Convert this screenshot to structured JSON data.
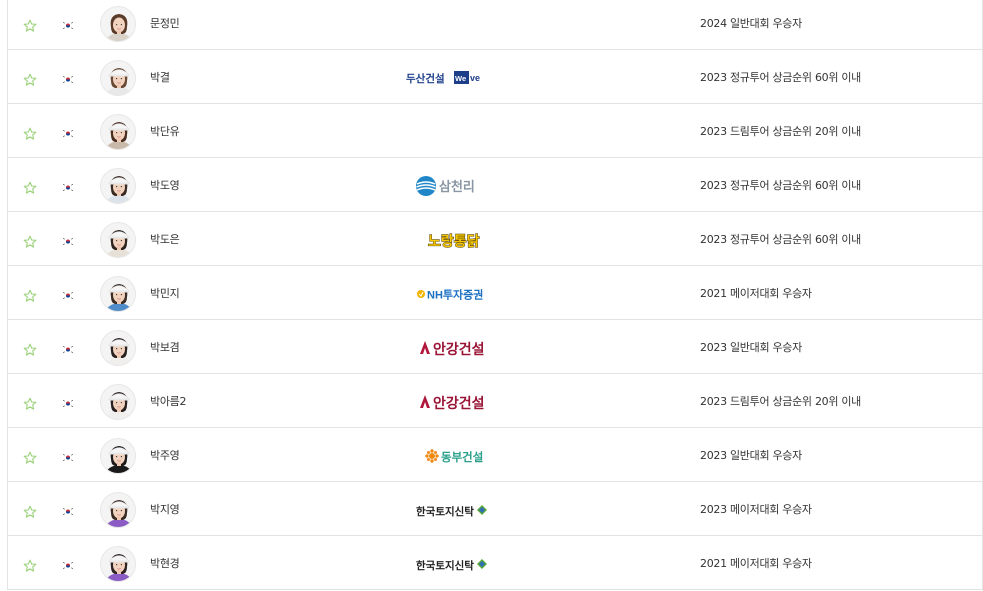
{
  "icons": {
    "favorite": "star-outline-icon",
    "flag": "korea-flag-icon"
  },
  "colors": {
    "star": "#9bd27a",
    "border": "#e3e3e3",
    "text": "#333333"
  },
  "players": [
    {
      "name": "문정민",
      "sponsor": "",
      "qualification": "2024 일반대회 우승자",
      "hair": "#5a3a28",
      "shirt": "#d8d2c8",
      "cap": false
    },
    {
      "name": "박결",
      "sponsor": "두산건설 We've",
      "qualification": "2023 정규투어 상금순위 60위 이내",
      "hair": "#6a4a34",
      "shirt": "#e8e8e8",
      "cap": true
    },
    {
      "name": "박단유",
      "sponsor": "",
      "qualification": "2023 드림투어 상금순위 20위 이내",
      "hair": "#4a2e20",
      "shirt": "#c9b9a8",
      "cap": true
    },
    {
      "name": "박도영",
      "sponsor": "삼천리",
      "qualification": "2023 정규투어 상금순위 60위 이내",
      "hair": "#3a2a22",
      "shirt": "#dde3ea",
      "cap": true
    },
    {
      "name": "박도은",
      "sponsor": "노랑통닭",
      "qualification": "2023 정규투어 상금순위 60위 이내",
      "hair": "#2e2420",
      "shirt": "#e6e0d6",
      "cap": true
    },
    {
      "name": "박민지",
      "sponsor": "NH투자증권",
      "qualification": "2021 메이저대회 우승자",
      "hair": "#3a2c24",
      "shirt": "#4f8cc9",
      "cap": true
    },
    {
      "name": "박보겸",
      "sponsor": "안강건설",
      "qualification": "2023 일반대회 우승자",
      "hair": "#2a2020",
      "shirt": "#f1eeee",
      "cap": true
    },
    {
      "name": "박아름2",
      "sponsor": "안강건설",
      "qualification": "2023 드림투어 상금순위 20위 이내",
      "hair": "#2a2020",
      "shirt": "#f1eeee",
      "cap": true
    },
    {
      "name": "박주영",
      "sponsor": "동부건설",
      "qualification": "2023 일반대회 우승자",
      "hair": "#1e1a1a",
      "shirt": "#1a1a1a",
      "cap": true
    },
    {
      "name": "박지영",
      "sponsor": "한국토지신탁",
      "qualification": "2023 메이저대회 우승자",
      "hair": "#3a2a24",
      "shirt": "#8a5cc4",
      "cap": true
    },
    {
      "name": "박현경",
      "sponsor": "한국토지신탁",
      "qualification": "2021 메이저대회 우승자",
      "hair": "#2e2222",
      "shirt": "#8a5cc4",
      "cap": true
    }
  ]
}
